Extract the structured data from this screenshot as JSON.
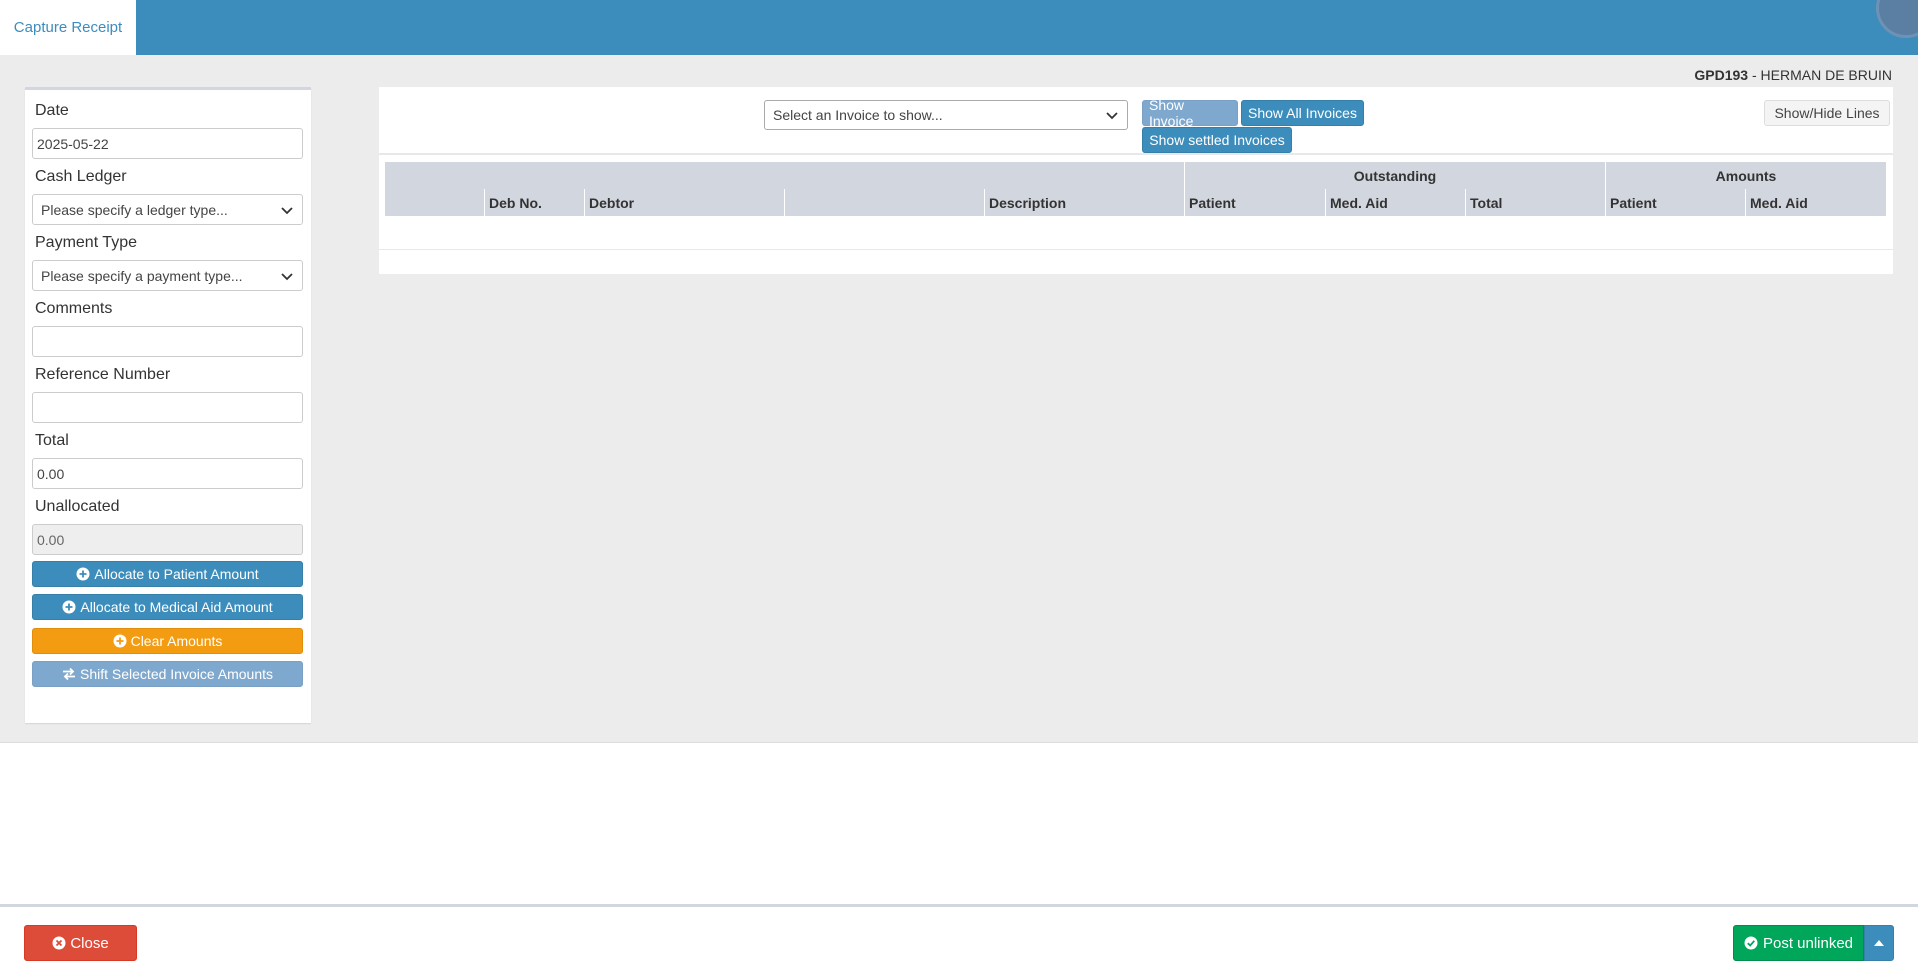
{
  "header": {
    "tab_label": "Capture Receipt"
  },
  "patient": {
    "code": "GPD193",
    "separator": " - ",
    "name": "HERMAN DE BRUIN"
  },
  "form": {
    "date_label": "Date",
    "date_value": "2025-05-22",
    "cash_ledger_label": "Cash Ledger",
    "cash_ledger_value": "Please specify a ledger type...",
    "payment_type_label": "Payment Type",
    "payment_type_value": "Please specify a payment type...",
    "comments_label": "Comments",
    "comments_value": "",
    "reference_label": "Reference Number",
    "reference_value": "",
    "total_label": "Total",
    "total_value": "0.00",
    "unallocated_label": "Unallocated",
    "unallocated_value": "0.00"
  },
  "actions": {
    "allocate_patient": "Allocate to Patient Amount",
    "allocate_medaid": "Allocate to Medical Aid Amount",
    "clear_amounts": "Clear Amounts",
    "shift_amounts": "Shift Selected Invoice Amounts"
  },
  "invoices": {
    "select_value": "Select an Invoice to show...",
    "show_invoice": "Show Invoice",
    "show_all": "Show All Invoices",
    "show_settled": "Show settled Invoices",
    "show_hide_lines": "Show/Hide Lines"
  },
  "table": {
    "group_outstanding": "Outstanding",
    "group_amounts": "Amounts",
    "col_deb_no": "Deb No.",
    "col_debtor": "Debtor",
    "col_description": "Description",
    "col_out_patient": "Patient",
    "col_out_medaid": "Med. Aid",
    "col_out_total": "Total",
    "col_amt_patient": "Patient",
    "col_amt_medaid": "Med. Aid"
  },
  "footer": {
    "close_label": "Close",
    "post_label": "Post unlinked"
  },
  "colors": {
    "primary": "#3c8dbc",
    "danger": "#dd4b39",
    "success": "#00a65a",
    "warning": "#f39c12"
  },
  "icons": [
    "chevron-down-icon",
    "plus-circle-icon",
    "exchange-icon",
    "close-circle-icon",
    "check-circle-icon",
    "caret-up-icon"
  ]
}
